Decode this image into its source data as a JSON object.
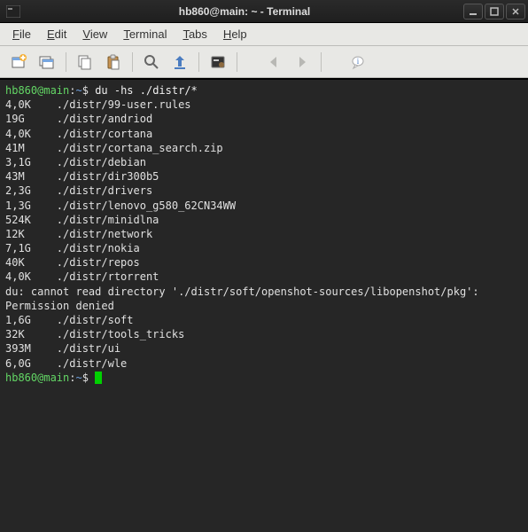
{
  "title": "hb860@main: ~ - Terminal",
  "menu": {
    "file": "File",
    "edit": "Edit",
    "view": "View",
    "terminal": "Terminal",
    "tabs": "Tabs",
    "help": "Help"
  },
  "prompt": {
    "userhost": "hb860@main",
    "colon": ":",
    "path": "~",
    "dollar": "$"
  },
  "command": "du -hs ./distr/*",
  "rows": [
    {
      "size": "4,0K",
      "path": "./distr/99-user.rules"
    },
    {
      "size": "19G",
      "path": "./distr/andriod"
    },
    {
      "size": "4,0K",
      "path": "./distr/cortana"
    },
    {
      "size": "41M",
      "path": "./distr/cortana_search.zip"
    },
    {
      "size": "3,1G",
      "path": "./distr/debian"
    },
    {
      "size": "43M",
      "path": "./distr/dir300b5"
    },
    {
      "size": "2,3G",
      "path": "./distr/drivers"
    },
    {
      "size": "1,3G",
      "path": "./distr/lenovo_g580_62CN34WW"
    },
    {
      "size": "524K",
      "path": "./distr/minidlna"
    },
    {
      "size": "12K",
      "path": "./distr/network"
    },
    {
      "size": "7,1G",
      "path": "./distr/nokia"
    },
    {
      "size": "40K",
      "path": "./distr/repos"
    },
    {
      "size": "4,0K",
      "path": "./distr/rtorrent"
    }
  ],
  "error": "du: cannot read directory './distr/soft/openshot-sources/libopenshot/pkg': Permission denied",
  "rows2": [
    {
      "size": "1,6G",
      "path": "./distr/soft"
    },
    {
      "size": "32K",
      "path": "./distr/tools_tricks"
    },
    {
      "size": "393M",
      "path": "./distr/ui"
    },
    {
      "size": "6,0G",
      "path": "./distr/wle"
    }
  ],
  "icons": {
    "newTab": "new-tab-icon",
    "newWindow": "new-window-icon",
    "copy": "copy-icon",
    "paste": "paste-icon",
    "find": "find-icon",
    "fullscreen": "fullscreen-icon",
    "gear": "gear-icon",
    "back": "back-icon",
    "forward": "forward-icon",
    "info": "info-icon"
  }
}
